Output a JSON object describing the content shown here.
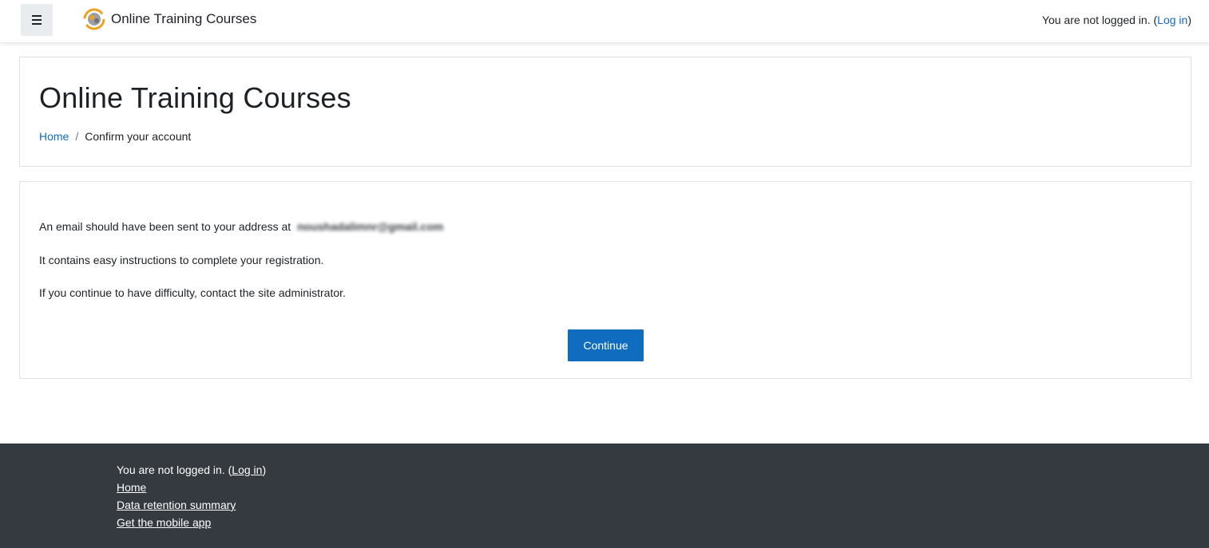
{
  "navbar": {
    "menu_icon": "hamburger-icon",
    "logo_icon": "site-logo-icon",
    "site_name": "Online Training Courses",
    "login_text": "You are not logged in.",
    "login_link": "Log in",
    "accent": "#0f6cbf"
  },
  "header": {
    "title": "Online Training Courses",
    "breadcrumb": {
      "home": "Home",
      "separator": "/",
      "current": "Confirm your account"
    }
  },
  "main": {
    "line1": "An email should have been sent to your address at",
    "email": "noushadalimnr@gmail.com",
    "line2": "It contains easy instructions to complete your registration.",
    "line3": "If you continue to have difficulty, contact the site administrator.",
    "continue_label": "Continue"
  },
  "footer": {
    "login_text": "You are not logged in.",
    "login_link": "Log in",
    "links": [
      "Home",
      "Data retention summary",
      "Get the mobile app"
    ],
    "bg": "#343a40"
  }
}
